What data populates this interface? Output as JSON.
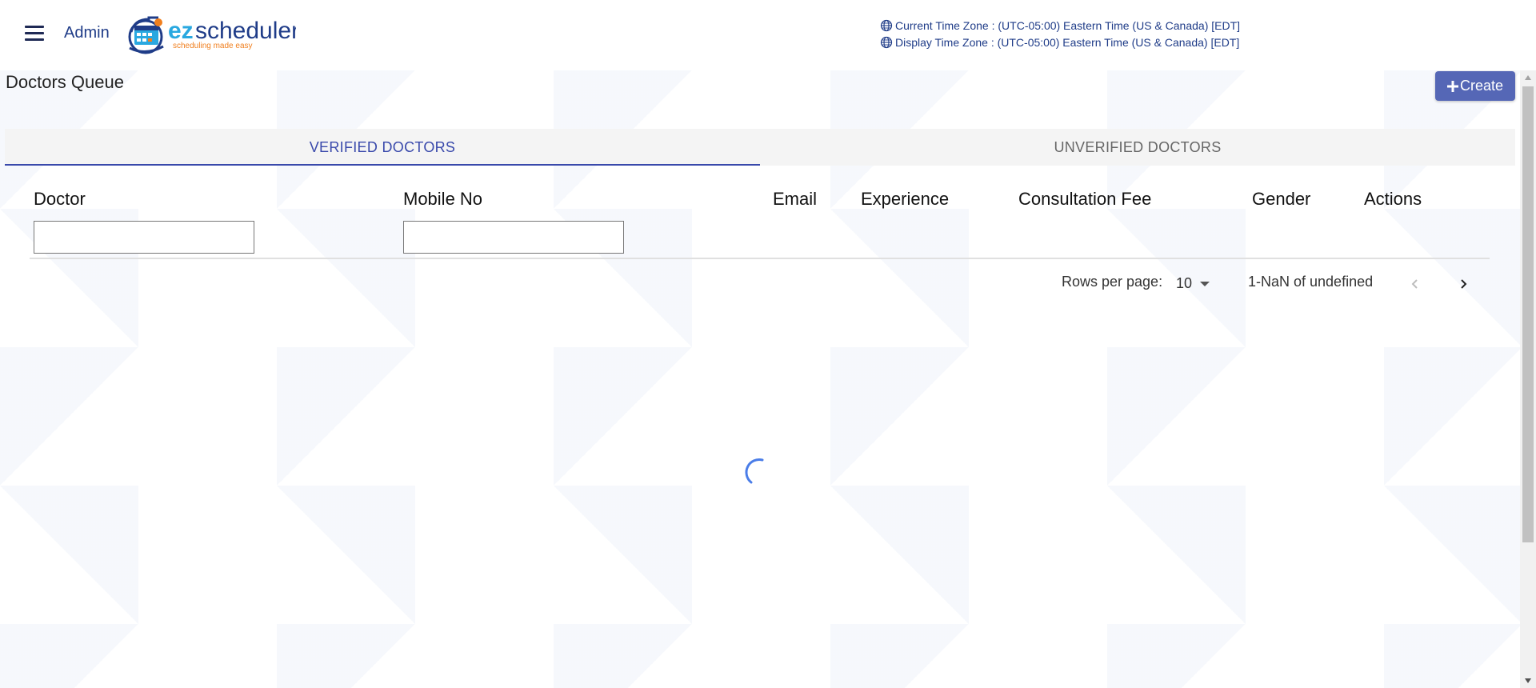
{
  "header": {
    "admin_label": "Admin",
    "logo_brand_ez": "ez",
    "logo_brand_rest": "scheduler",
    "logo_tagline": "scheduling made easy",
    "current_time_zone": "Current Time Zone : (UTC-05:00) Eastern Time (US & Canada) [EDT]",
    "display_time_zone": "Display Time Zone : (UTC-05:00) Eastern Time (US & Canada) [EDT]"
  },
  "page": {
    "title": "Doctors Queue",
    "create_label": "Create"
  },
  "tabs": [
    {
      "label": "VERIFIED DOCTORS",
      "active": true
    },
    {
      "label": "UNVERIFIED DOCTORS",
      "active": false
    }
  ],
  "table": {
    "columns": [
      "Doctor",
      "Mobile No",
      "Email",
      "Experience",
      "Consultation Fee",
      "Gender",
      "Actions"
    ],
    "filters": {
      "doctor_value": "",
      "mobile_value": ""
    }
  },
  "pagination": {
    "rows_per_page_label": "Rows per page:",
    "rows_per_page_value": "10",
    "range_text": "1-NaN of undefined"
  },
  "loading": true,
  "colors": {
    "accent": "#3949ab",
    "create_button": "#5567b6",
    "header_text": "#1f3c88",
    "logo_ez": "#29a8e0",
    "logo_tagline": "#f07f1e"
  },
  "icons": {
    "menu": "hamburger-icon",
    "timezone": "globe-icon",
    "create": "plus-icon",
    "rows_select": "caret-down-icon",
    "prev_page": "chevron-left-icon",
    "next_page": "chevron-right-icon",
    "loading": "spinner-icon"
  }
}
